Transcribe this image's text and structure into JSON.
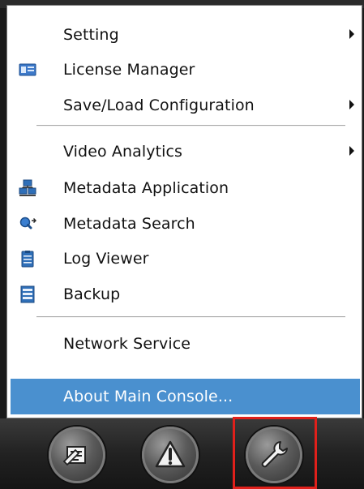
{
  "menu": {
    "items": [
      {
        "label": "Setting",
        "icon": "",
        "submenu": true
      },
      {
        "label": "License Manager",
        "icon": "license-card-icon",
        "submenu": false
      },
      {
        "label": "Save/Load Configuration",
        "icon": "",
        "submenu": true
      },
      {
        "label": "Video Analytics",
        "icon": "",
        "submenu": true
      },
      {
        "label": "Metadata Application",
        "icon": "metadata-app-icon",
        "submenu": false
      },
      {
        "label": "Metadata Search",
        "icon": "magnifier-search-icon",
        "submenu": false
      },
      {
        "label": "Log Viewer",
        "icon": "clipboard-log-icon",
        "submenu": false
      },
      {
        "label": "Backup",
        "icon": "backup-icon",
        "submenu": false
      },
      {
        "label": "Network Service",
        "icon": "",
        "submenu": false
      },
      {
        "label": "About Main Console...",
        "icon": "",
        "submenu": false,
        "highlighted": true
      }
    ]
  },
  "toolbar": {
    "buttons": [
      {
        "icon": "edit-document-icon"
      },
      {
        "icon": "warning-icon"
      },
      {
        "icon": "wrench-settings-icon",
        "selected": true
      }
    ]
  },
  "colors": {
    "highlight": "#4a90cf",
    "selection_frame": "#e0201b"
  }
}
